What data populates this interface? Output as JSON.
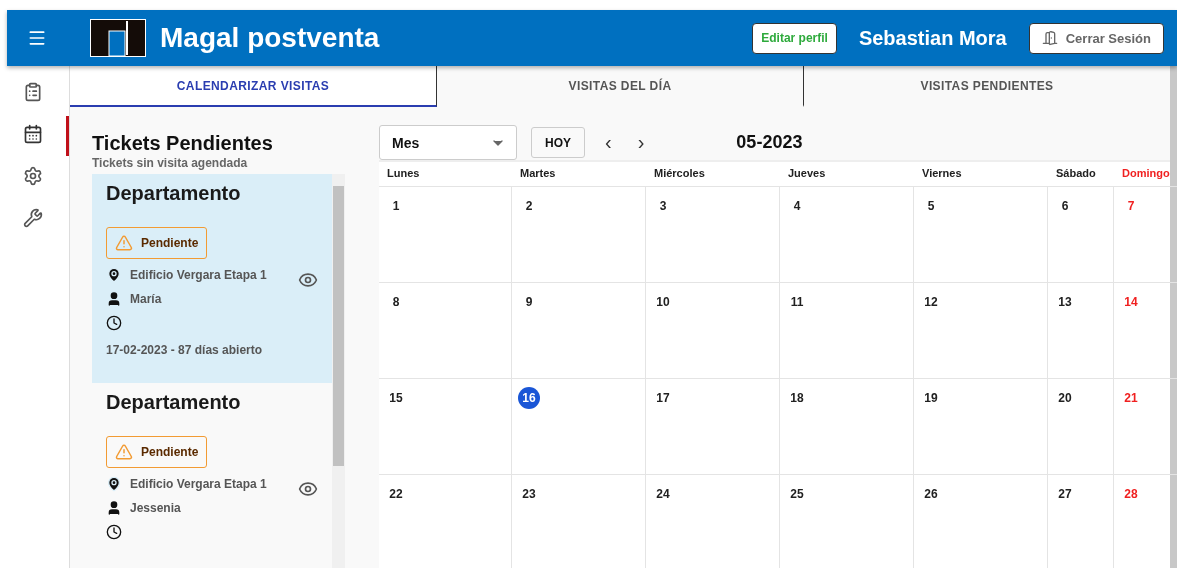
{
  "header": {
    "title": "Magal postventa",
    "edit_button": "Editar perfil",
    "user": "Sebastian Mora",
    "logout_button": "Cerrar Sesión"
  },
  "sidebar": {
    "items": [
      {
        "kind": "clipboard",
        "selected": false
      },
      {
        "kind": "calendar",
        "selected": true
      },
      {
        "kind": "gear",
        "selected": false
      },
      {
        "kind": "wrench",
        "selected": false
      }
    ]
  },
  "tabs": [
    {
      "label": "CALENDARIZAR VISITAS",
      "selected": true
    },
    {
      "label": "VISITAS DEL DÍA",
      "selected": false
    },
    {
      "label": "VISITAS PENDIENTES",
      "selected": false
    }
  ],
  "tickets": {
    "title": "Tickets Pendientes",
    "subtitle": "Tickets sin visita agendada",
    "items": [
      {
        "title": "Departamento",
        "status": "Pendiente",
        "building": "Edificio Vergara Etapa 1",
        "person": "María",
        "opened": "17-02-2023 - 87 días abierto",
        "selected": true
      },
      {
        "title": "Departamento",
        "status": "Pendiente",
        "building": "Edificio Vergara Etapa 1",
        "person": "Jessenia",
        "selected": false
      }
    ]
  },
  "calendar": {
    "view": "Mes",
    "today_button": "HOY",
    "prev": "‹",
    "next": "›",
    "period": "05-2023",
    "columns": [
      {
        "label": "Lunes",
        "color": "#212121"
      },
      {
        "label": "Martes",
        "color": "#212121"
      },
      {
        "label": "Miércoles",
        "color": "#212121"
      },
      {
        "label": "Jueves",
        "color": "#212121"
      },
      {
        "label": "Viernes",
        "color": "#212121"
      },
      {
        "label": "Sábado",
        "color": "#212121"
      },
      {
        "label": "Domingo",
        "color": "#f02020"
      }
    ],
    "weeks": [
      [
        {
          "label": "1",
          "today": false
        },
        {
          "label": "2",
          "today": false
        },
        {
          "label": "3",
          "today": false
        },
        {
          "label": "4",
          "today": false
        },
        {
          "label": "5",
          "today": false
        },
        {
          "label": "6",
          "today": false
        },
        {
          "label": "7",
          "today": false
        }
      ],
      [
        {
          "label": "8",
          "today": false
        },
        {
          "label": "9",
          "today": false
        },
        {
          "label": "10",
          "today": false
        },
        {
          "label": "11",
          "today": false
        },
        {
          "label": "12",
          "today": false
        },
        {
          "label": "13",
          "today": false
        },
        {
          "label": "14",
          "today": false
        }
      ],
      [
        {
          "label": "15",
          "today": false
        },
        {
          "label": "16",
          "today": true
        },
        {
          "label": "17",
          "today": false
        },
        {
          "label": "18",
          "today": false
        },
        {
          "label": "19",
          "today": false
        },
        {
          "label": "20",
          "today": false
        },
        {
          "label": "21",
          "today": false
        }
      ],
      [
        {
          "label": "22",
          "today": false
        },
        {
          "label": "23",
          "today": false
        },
        {
          "label": "24",
          "today": false
        },
        {
          "label": "25",
          "today": false
        },
        {
          "label": "26",
          "today": false
        },
        {
          "label": "27",
          "today": false
        },
        {
          "label": "28",
          "today": false
        }
      ]
    ]
  }
}
